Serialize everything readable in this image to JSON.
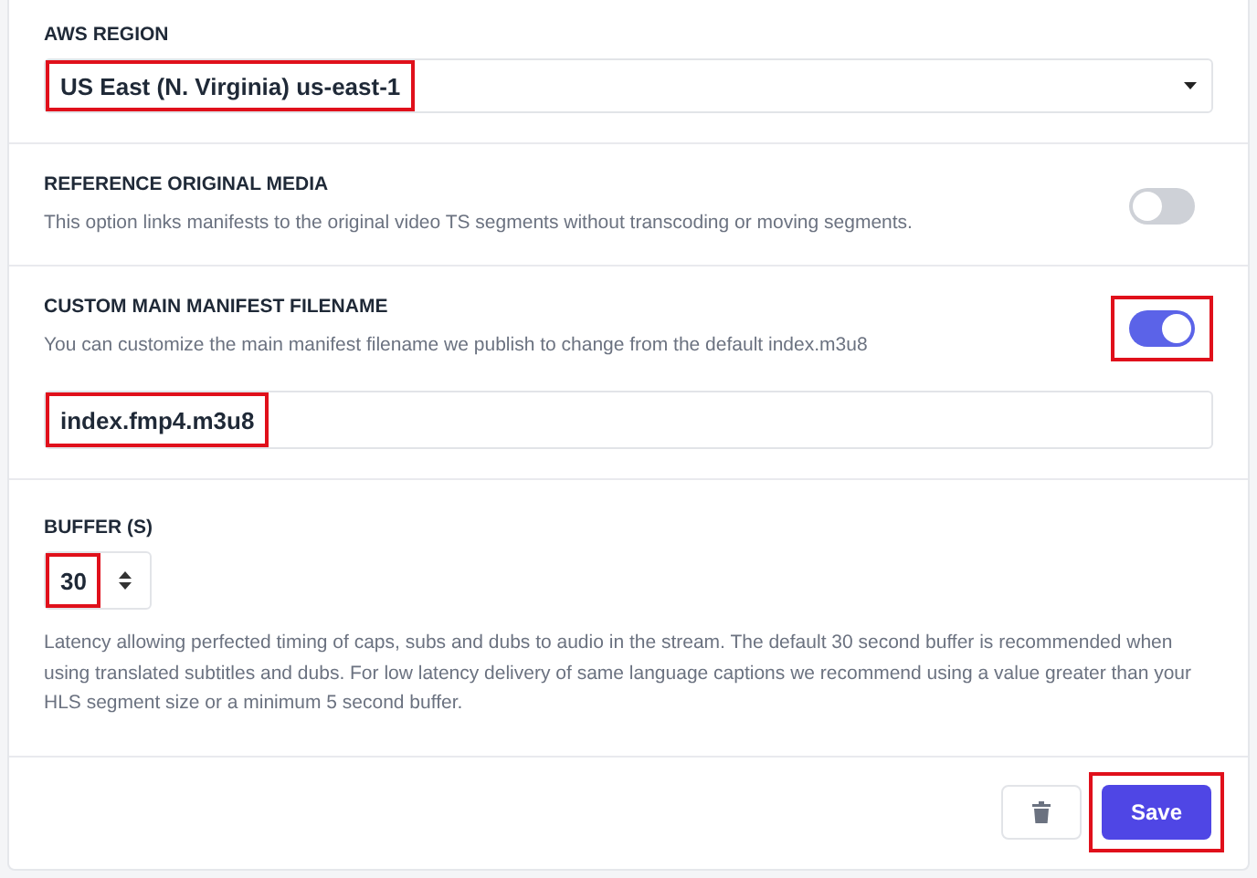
{
  "region": {
    "label": "AWS REGION",
    "value": "US East (N. Virginia) us-east-1",
    "highlighted": true
  },
  "reference_media": {
    "label": "REFERENCE ORIGINAL MEDIA",
    "description": "This option links manifests to the original video TS segments without transcoding or moving segments.",
    "on": false
  },
  "custom_manifest": {
    "label": "CUSTOM MAIN MANIFEST FILENAME",
    "description": "You can customize the main manifest filename we publish to change from the default index.m3u8",
    "on": true,
    "highlighted": true,
    "filename": "index.fmp4.m3u8",
    "filename_highlighted": true
  },
  "buffer": {
    "label": "BUFFER (S)",
    "value": "30",
    "highlighted": true,
    "description": "Latency allowing perfected timing of caps, subs and dubs to audio in the stream. The default 30 second buffer is recommended when using translated subtitles and dubs. For low latency delivery of same language captions we recommend using a value greater than your HLS segment size or a minimum 5 second buffer."
  },
  "actions": {
    "save": "Save",
    "save_highlighted": true
  }
}
